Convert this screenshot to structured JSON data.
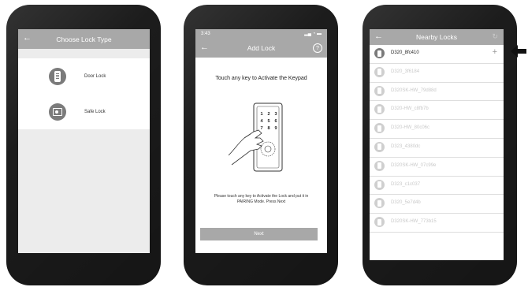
{
  "screen1": {
    "title": "Choose Lock Type",
    "options": [
      {
        "label": "Door Lock",
        "icon": "door-lock-icon"
      },
      {
        "label": "Safe Lock",
        "icon": "safe-icon"
      }
    ]
  },
  "screen2": {
    "status_time": "3:43",
    "title": "Add Lock",
    "help_label": "?",
    "instruction_title": "Touch any key to Activate the Keypad",
    "instruction_bottom": "Please touch any key to Activate the Lock and put it in PAIRING Mode. Press Next",
    "next_label": "Next",
    "keypad_keys": [
      "1",
      "2",
      "3",
      "4",
      "5",
      "6",
      "7",
      "8",
      "9"
    ]
  },
  "screen3": {
    "title": "Nearby Locks",
    "locks": [
      {
        "name": "D320_8fc410",
        "icon": "lock-icon",
        "action": "+"
      },
      {
        "name": "D320_3f6184",
        "icon": "lock-icon"
      },
      {
        "name": "D320SK-HW_79d88d",
        "icon": "lock-icon"
      },
      {
        "name": "D320-HW_c8fb7b",
        "icon": "lock-icon"
      },
      {
        "name": "D320-HW_80c06c",
        "icon": "lock-icon"
      },
      {
        "name": "D323_4380dc",
        "icon": "lock-icon"
      },
      {
        "name": "D320SK-HW_07c99e",
        "icon": "lock-icon"
      },
      {
        "name": "D323_c1c037",
        "icon": "lock-icon"
      },
      {
        "name": "D320_5e7d4b",
        "icon": "lock-icon"
      },
      {
        "name": "D320SK-HW_773b15",
        "icon": "lock-icon"
      }
    ]
  }
}
